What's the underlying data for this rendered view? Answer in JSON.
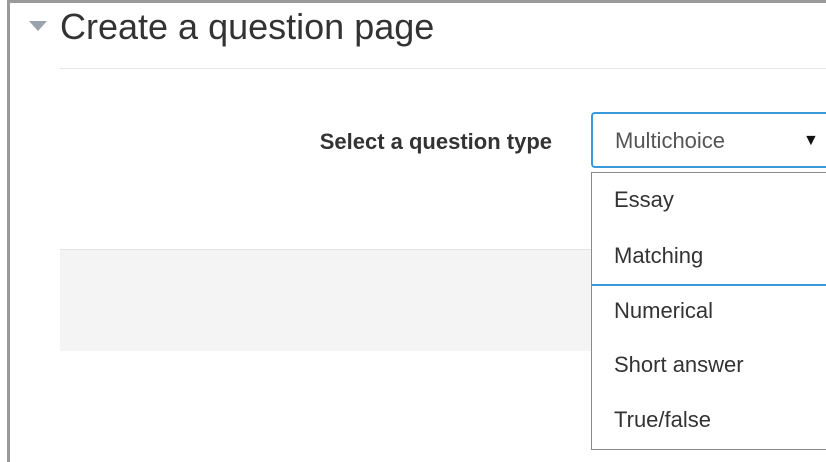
{
  "section": {
    "title": "Create a question page",
    "collapse_icon": "triangle-down-icon"
  },
  "form": {
    "question_type_label": "Select a question type",
    "question_type_select": {
      "selected_value": "Multichoice",
      "arrow_icon": "dropdown-arrow-icon",
      "options": [
        "Essay",
        "Matching",
        "Numerical",
        "Short answer",
        "True/false"
      ]
    }
  },
  "colors": {
    "focus_border": "#3a9ad9",
    "panel_background": "#f4f4f4",
    "text": "#333333"
  }
}
